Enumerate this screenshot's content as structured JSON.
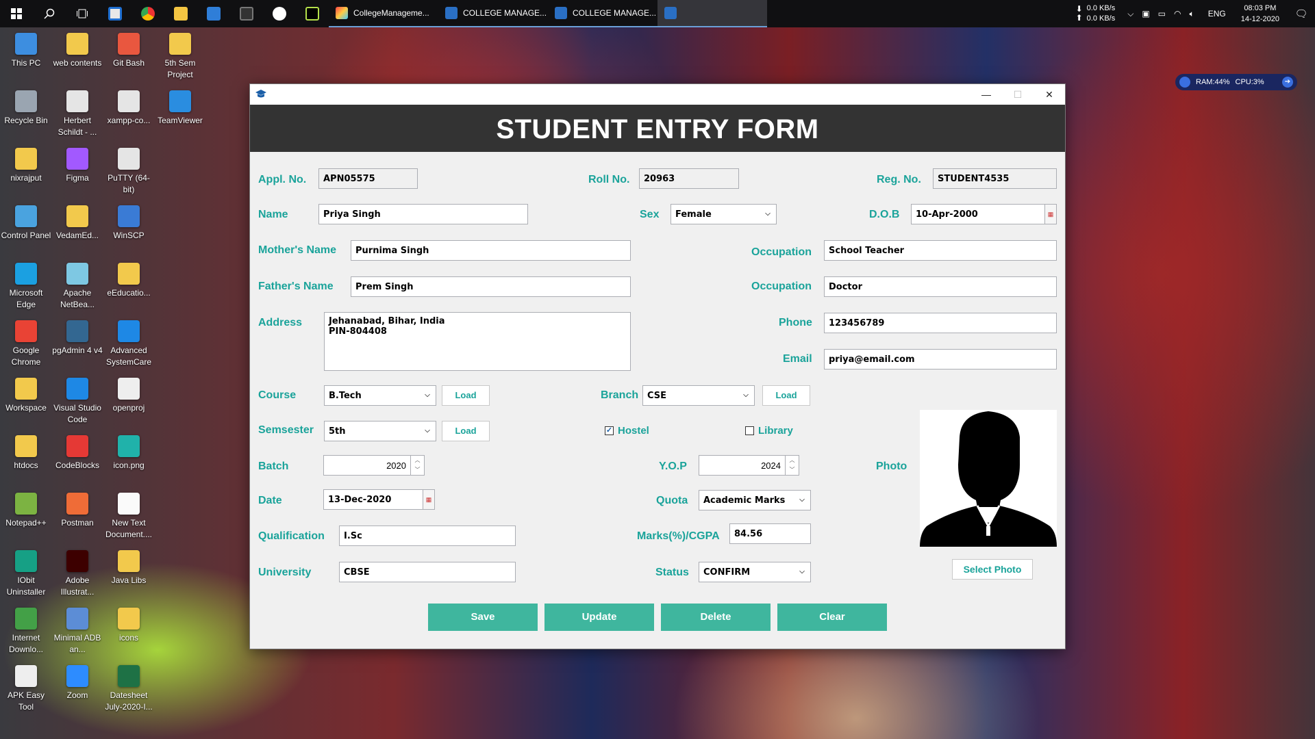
{
  "taskbar": {
    "tasks": [
      {
        "label": "CollegeManageme..."
      },
      {
        "label": "COLLEGE MANAGE..."
      },
      {
        "label": "COLLEGE MANAGE..."
      },
      {
        "label": ""
      }
    ],
    "net_up": "0.0 KB/s",
    "net_down": "0.0 KB/s",
    "lang": "ENG",
    "time": "08:03 PM",
    "date": "14-12-2020"
  },
  "desktop_icons": [
    {
      "label": "This PC"
    },
    {
      "label": "web contents"
    },
    {
      "label": "Git Bash"
    },
    {
      "label": "5th Sem Project"
    },
    {
      "label": "Recycle Bin"
    },
    {
      "label": "Herbert Schildt - ..."
    },
    {
      "label": "xampp-co..."
    },
    {
      "label": "TeamViewer"
    },
    {
      "label": "nixrajput"
    },
    {
      "label": "Figma"
    },
    {
      "label": "PuTTY (64-bit)"
    },
    {
      "label": "Control Panel"
    },
    {
      "label": "VedamEd..."
    },
    {
      "label": "WinSCP"
    },
    {
      "label": "Microsoft Edge"
    },
    {
      "label": "Apache NetBea..."
    },
    {
      "label": "eEducatio..."
    },
    {
      "label": "Google Chrome"
    },
    {
      "label": "pgAdmin 4 v4"
    },
    {
      "label": "Advanced SystemCare"
    },
    {
      "label": "Workspace"
    },
    {
      "label": "Visual Studio Code"
    },
    {
      "label": "openproj"
    },
    {
      "label": "htdocs"
    },
    {
      "label": "CodeBlocks"
    },
    {
      "label": "icon.png"
    },
    {
      "label": "Notepad++"
    },
    {
      "label": "Postman"
    },
    {
      "label": "New Text Document...."
    },
    {
      "label": "IObit Uninstaller"
    },
    {
      "label": "Adobe Illustrat..."
    },
    {
      "label": "Java Libs"
    },
    {
      "label": "Internet Downlo..."
    },
    {
      "label": "Minimal ADB an..."
    },
    {
      "label": "icons"
    },
    {
      "label": "APK Easy Tool"
    },
    {
      "label": "Zoom"
    },
    {
      "label": "Datesheet July-2020-I..."
    }
  ],
  "system_widget": {
    "ram": "RAM:44%",
    "cpu": "CPU:3%"
  },
  "window": {
    "title": "",
    "header": "STUDENT ENTRY FORM"
  },
  "form": {
    "appl_no": {
      "label": "Appl. No.",
      "value": "APN05575"
    },
    "roll_no": {
      "label": "Roll No.",
      "value": "20963"
    },
    "reg_no": {
      "label": "Reg. No.",
      "value": "STUDENT4535"
    },
    "name": {
      "label": "Name",
      "value": "Priya Singh"
    },
    "sex": {
      "label": "Sex",
      "value": "Female"
    },
    "dob": {
      "label": "D.O.B",
      "value": "10-Apr-2000"
    },
    "mother_name": {
      "label": "Mother's Name",
      "value": "Purnima Singh"
    },
    "mother_occupation": {
      "label": "Occupation",
      "value": "School Teacher"
    },
    "father_name": {
      "label": "Father's Name",
      "value": "Prem Singh"
    },
    "father_occupation": {
      "label": "Occupation",
      "value": "Doctor"
    },
    "address": {
      "label": "Address",
      "line1": "Jehanabad, Bihar, India",
      "line2": "PIN-804408"
    },
    "phone": {
      "label": "Phone",
      "value": "123456789"
    },
    "email": {
      "label": "Email",
      "value": "priya@email.com"
    },
    "course": {
      "label": "Course",
      "value": "B.Tech",
      "load": "Load"
    },
    "branch": {
      "label": "Branch",
      "value": "CSE",
      "load": "Load"
    },
    "semester": {
      "label": "Semsester",
      "value": "5th",
      "load": "Load"
    },
    "hostel": {
      "label": "Hostel",
      "checked": true
    },
    "library": {
      "label": "Library",
      "checked": false
    },
    "batch": {
      "label": "Batch",
      "value": "2020"
    },
    "yop": {
      "label": "Y.O.P",
      "value": "2024"
    },
    "photo": {
      "label": "Photo",
      "select_label": "Select Photo"
    },
    "date": {
      "label": "Date",
      "value": "13-Dec-2020"
    },
    "quota": {
      "label": "Quota",
      "value": "Academic Marks"
    },
    "qualification": {
      "label": "Qualification",
      "value": "I.Sc"
    },
    "marks": {
      "label": "Marks(%)/CGPA",
      "value": "84.56"
    },
    "university": {
      "label": "University",
      "value": "CBSE"
    },
    "status": {
      "label": "Status",
      "value": "CONFIRM"
    }
  },
  "actions": {
    "save": "Save",
    "update": "Update",
    "delete": "Delete",
    "clear": "Clear"
  },
  "colors": {
    "accent": "#1aa39a",
    "button": "#3fb69e",
    "header_bg": "#333333"
  }
}
